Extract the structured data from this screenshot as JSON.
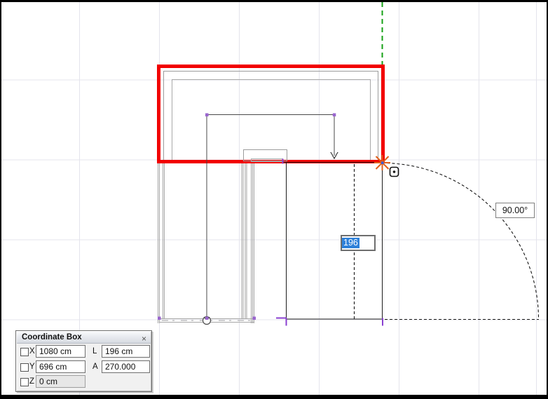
{
  "canvas": {
    "length_input_value": "196",
    "angle_label": "90.00°"
  },
  "coordinate_box": {
    "title": "Coordinate Box",
    "close": "×",
    "rows": [
      {
        "axis": "X",
        "value": "1080 cm",
        "label2": "L",
        "value2": "196 cm"
      },
      {
        "axis": "Y",
        "value": "696 cm",
        "label2": "A",
        "value2": "270.000"
      },
      {
        "axis": "Z",
        "value": "0 cm"
      }
    ]
  },
  "colors": {
    "selection_red": "#f20000",
    "guide_green": "#14a014",
    "snap_orange": "#e2601c",
    "handle_purple": "#9a66cf",
    "highlight_blue": "#2f81d9",
    "grid": "#e4e4ec"
  }
}
